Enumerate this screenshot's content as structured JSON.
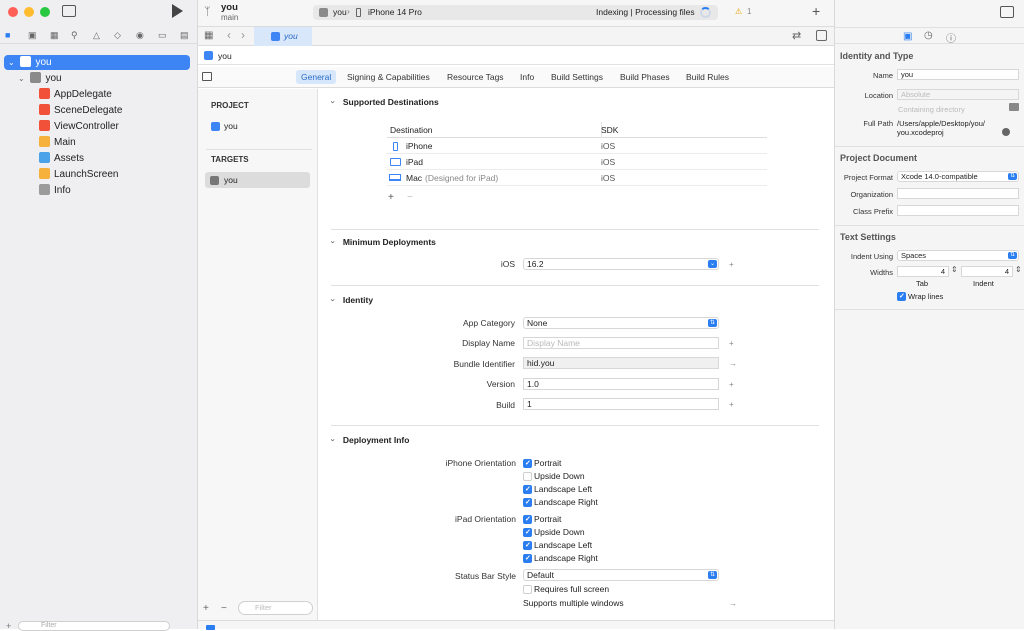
{
  "window": {
    "traffic_lights": [
      "#ff5f57",
      "#febc2e",
      "#28c840"
    ]
  },
  "toolbar": {
    "project": "you",
    "branch": "main",
    "scheme": "you",
    "device": "iPhone 14 Pro",
    "status": "Indexing | Processing files",
    "warnings": "1",
    "add_label": "+"
  },
  "navigator": {
    "filter_placeholder": "Filter",
    "tree": [
      {
        "label": "you",
        "level": 0,
        "icon": "app-icon",
        "selected": true
      },
      {
        "label": "you",
        "level": 1,
        "icon": "folder-icon"
      },
      {
        "label": "AppDelegate",
        "level": 2,
        "icon": "swift-icon"
      },
      {
        "label": "SceneDelegate",
        "level": 2,
        "icon": "swift-icon"
      },
      {
        "label": "ViewController",
        "level": 2,
        "icon": "swift-icon"
      },
      {
        "label": "Main",
        "level": 2,
        "icon": "storyboard-icon"
      },
      {
        "label": "Assets",
        "level": 2,
        "icon": "assets-icon"
      },
      {
        "label": "LaunchScreen",
        "level": 2,
        "icon": "storyboard-icon"
      },
      {
        "label": "Info",
        "level": 2,
        "icon": "plist-icon"
      }
    ]
  },
  "editor": {
    "tab": "you",
    "breadcrumb": "you",
    "segments": [
      "General",
      "Signing & Capabilities",
      "Resource Tags",
      "Info",
      "Build Settings",
      "Build Phases",
      "Build Rules"
    ],
    "selected_segment": "General",
    "project_header": "PROJECT",
    "project_item": "you",
    "targets_header": "TARGETS",
    "target_item": "you",
    "filter_placeholder": "Filter"
  },
  "supported_destinations": {
    "title": "Supported Destinations",
    "col_dest": "Destination",
    "col_sdk": "SDK",
    "rows": [
      {
        "name": "iPhone",
        "suffix": "",
        "sdk": "iOS"
      },
      {
        "name": "iPad",
        "suffix": "",
        "sdk": "iOS"
      },
      {
        "name": "Mac",
        "suffix": "(Designed for iPad)",
        "sdk": "iOS"
      }
    ]
  },
  "minimum_deployments": {
    "title": "Minimum Deployments",
    "label": "iOS",
    "value": "16.2"
  },
  "identity": {
    "title": "Identity",
    "app_category_label": "App Category",
    "app_category": "None",
    "display_name_label": "Display Name",
    "display_name_placeholder": "Display Name",
    "bundle_id_label": "Bundle Identifier",
    "bundle_id": "hid.you",
    "version_label": "Version",
    "version": "1.0",
    "build_label": "Build",
    "build": "1"
  },
  "deployment_info": {
    "title": "Deployment Info",
    "iphone_label": "iPhone Orientation",
    "iphone": [
      {
        "label": "Portrait",
        "on": true
      },
      {
        "label": "Upside Down",
        "on": false
      },
      {
        "label": "Landscape Left",
        "on": true
      },
      {
        "label": "Landscape Right",
        "on": true
      }
    ],
    "ipad_label": "iPad Orientation",
    "ipad": [
      {
        "label": "Portrait",
        "on": true
      },
      {
        "label": "Upside Down",
        "on": true
      },
      {
        "label": "Landscape Left",
        "on": true
      },
      {
        "label": "Landscape Right",
        "on": true
      }
    ],
    "status_bar_label": "Status Bar Style",
    "status_bar": "Default",
    "full_screen_label": "Requires full screen",
    "full_screen": false,
    "multi_windows_label": "Supports multiple windows"
  },
  "inspector": {
    "identity_title": "Identity and Type",
    "name_label": "Name",
    "name": "you",
    "location_label": "Location",
    "location": "Absolute",
    "location_hint": "Containing directory",
    "full_path_label": "Full Path",
    "full_path_1": "/Users/apple/Desktop/you/",
    "full_path_2": "you.xcodeproj",
    "project_doc_title": "Project Document",
    "format_label": "Project Format",
    "format": "Xcode 14.0-compatible",
    "org_label": "Organization",
    "prefix_label": "Class Prefix",
    "text_title": "Text Settings",
    "indent_using_label": "Indent Using",
    "indent_using": "Spaces",
    "widths_label": "Widths",
    "tab_width": "4",
    "indent_width": "4",
    "tab_label": "Tab",
    "indent_label": "Indent",
    "wrap_label": "Wrap lines",
    "wrap": true
  },
  "colors": {
    "accent": "#2a7ef1",
    "selection": "#3d84f5"
  }
}
